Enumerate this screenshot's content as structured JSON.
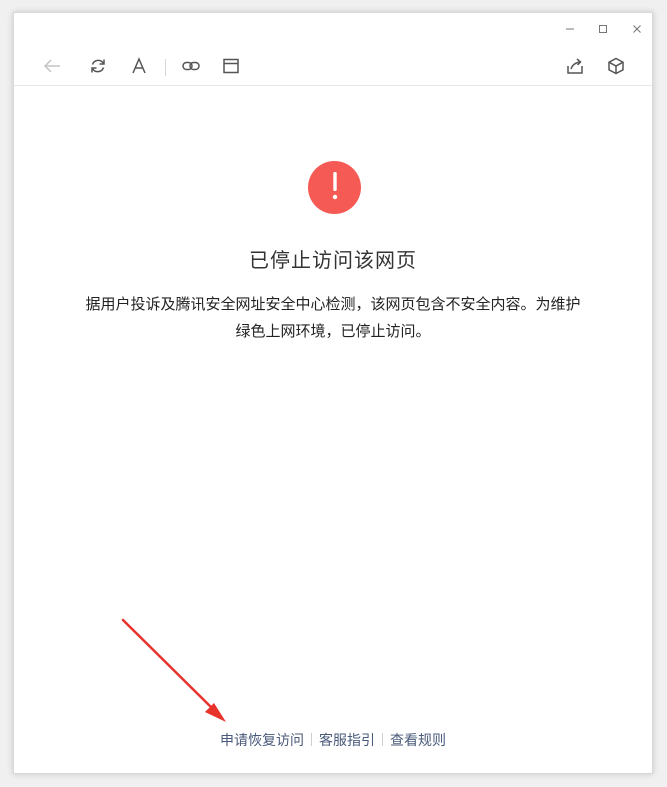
{
  "page": {
    "title": "已停止访问该网页",
    "description_line1": "据用户投诉及腾讯安全网址安全中心检测，该网页包含不安全内容。为维护",
    "description_line2": "绿色上网环境，已停止访问。"
  },
  "footer_links": [
    {
      "label": "申请恢复访问"
    },
    {
      "label": "客服指引"
    },
    {
      "label": "查看规则"
    }
  ],
  "colors": {
    "alert": "#f55a55",
    "annotation_arrow": "#e8322c",
    "link": "#4a5a7a"
  },
  "icons": {
    "toolbar": [
      "back-arrow-icon",
      "refresh-icon",
      "font-icon",
      "link-icon",
      "browser-window-icon",
      "share-icon",
      "cube-icon"
    ],
    "titlebar": [
      "minimize-icon",
      "maximize-icon",
      "close-icon"
    ],
    "alert": "exclamation-icon"
  }
}
